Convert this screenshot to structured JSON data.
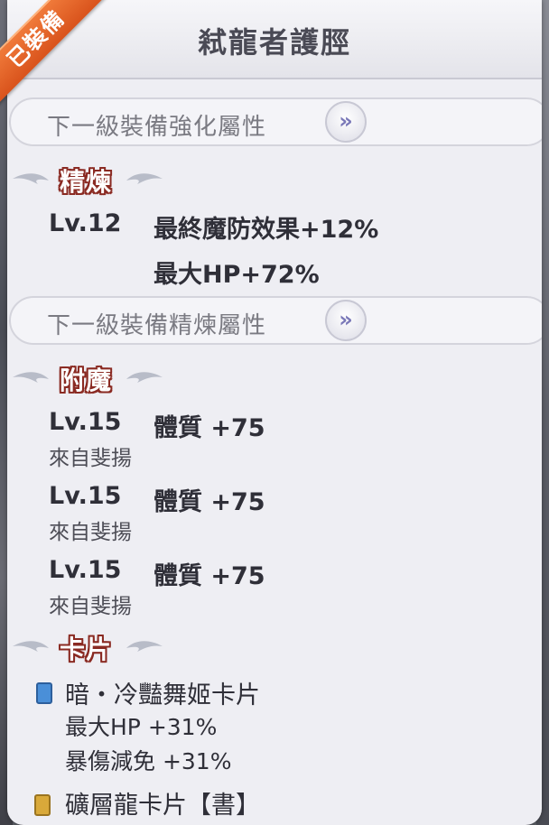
{
  "badge": "已裝備",
  "title": "弒龍者護脛",
  "next_enhance_btn": "下一級裝備強化屬性",
  "next_refine_btn": "下一級裝備精煉屬性",
  "chevron": "»",
  "refine": {
    "heading": "精煉",
    "level": "Lv.12",
    "effects": [
      "最終魔防效果+12%",
      "最大HP+72%"
    ]
  },
  "enchant": {
    "heading": "附魔",
    "entries": [
      {
        "level": "Lv.15",
        "stat": "體質 +75",
        "source": "來自斐揚"
      },
      {
        "level": "Lv.15",
        "stat": "體質 +75",
        "source": "來自斐揚"
      },
      {
        "level": "Lv.15",
        "stat": "體質 +75",
        "source": "來自斐揚"
      }
    ]
  },
  "cards": {
    "heading": "卡片",
    "items": [
      {
        "name": "暗・冷豔舞姬卡片",
        "effects": [
          "最大HP +31%",
          "暴傷減免 +31%"
        ],
        "color": "#4a8fd8"
      },
      {
        "name": "礦層龍卡片【書】",
        "effects": [],
        "color": "#d9a93a"
      }
    ]
  },
  "colors": {
    "accent_ribbon": "#e0602a",
    "heading_outline": "#8a2a22",
    "chevron": "#7a78b8"
  }
}
